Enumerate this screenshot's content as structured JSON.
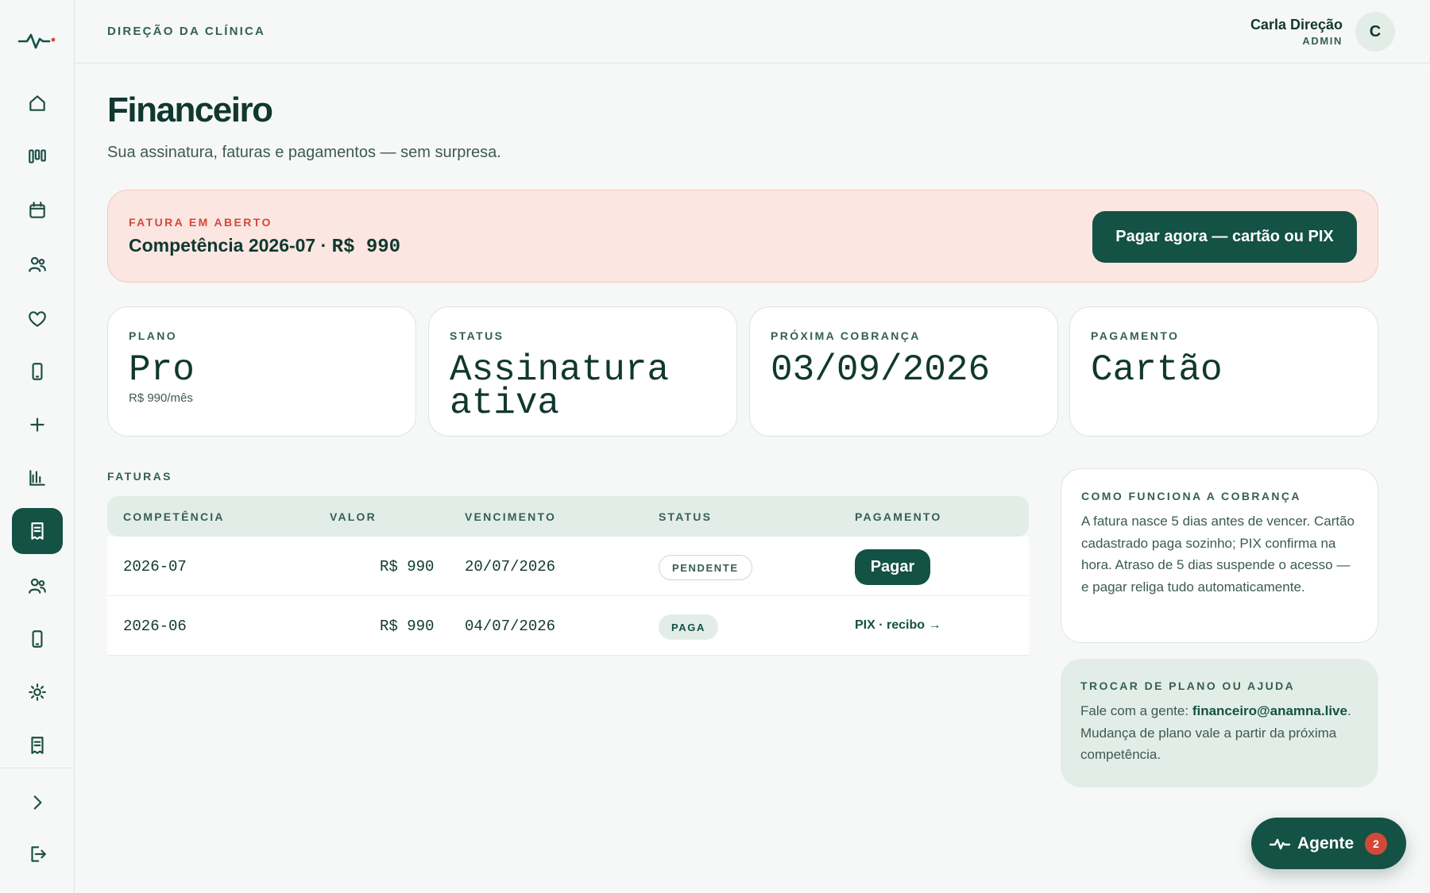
{
  "topbar": {
    "org": "DIREÇÃO DA CLÍNICA",
    "user_name": "Carla Direção",
    "user_role": "ADMIN",
    "avatar_initial": "C"
  },
  "sidebar": {
    "items": [
      {
        "icon": "home-icon"
      },
      {
        "icon": "kanban-icon"
      },
      {
        "icon": "calendar-icon"
      },
      {
        "icon": "patients-icon"
      },
      {
        "icon": "heart-icon"
      },
      {
        "icon": "phone-icon"
      },
      {
        "icon": "plus-icon"
      },
      {
        "icon": "bar-chart-icon"
      },
      {
        "icon": "receipt-icon",
        "active": true
      },
      {
        "icon": "team-icon"
      },
      {
        "icon": "tablet-icon"
      },
      {
        "icon": "sun-icon"
      },
      {
        "icon": "document-icon"
      },
      {
        "icon": "chevron-right-icon"
      },
      {
        "icon": "logout-icon"
      }
    ]
  },
  "header": {
    "title": "Financeiro",
    "subtitle": "Sua assinatura, faturas e pagamentos — sem surpresa."
  },
  "alert": {
    "label": "FATURA EM ABERTO",
    "text_prefix": "Competência 2026-07 · ",
    "text_amount": "R$ 990",
    "button": "Pagar agora — cartão ou PIX"
  },
  "cards": {
    "plan": {
      "label": "PLANO",
      "value": "Pro",
      "sub": "R$ 990/mês"
    },
    "status": {
      "label": "STATUS",
      "value_line1": "Assinatura",
      "value_line2": "ativa"
    },
    "next": {
      "label": "PRÓXIMA COBRANÇA",
      "value": "03/09/2026"
    },
    "payment": {
      "label": "PAGAMENTO",
      "value": "Cartão"
    }
  },
  "invoices": {
    "label": "FATURAS",
    "columns": [
      "COMPETÊNCIA",
      "VALOR",
      "VENCIMENTO",
      "STATUS",
      "PAGAMENTO"
    ],
    "rows": [
      {
        "period": "2026-07",
        "amount": "R$ 990",
        "due": "20/07/2026",
        "status": "PENDENTE",
        "action": "Pagar"
      },
      {
        "period": "2026-06",
        "amount": "R$ 990",
        "due": "04/07/2026",
        "status": "PAGA",
        "action": "PIX · recibo →"
      }
    ]
  },
  "info_how": {
    "label": "COMO FUNCIONA A COBRANÇA",
    "text": "A fatura nasce 5 dias antes de vencer. Cartão cadastrado paga sozinho; PIX confirma na hora. Atraso de 5 dias suspende o acesso — e pagar religa tudo automaticamente."
  },
  "info_help": {
    "label": "TROCAR DE PLANO OU AJUDA",
    "text_prefix": "Fale com a gente: ",
    "email": "financeiro@anamna.live",
    "text_suffix": ". Mudança de plano vale a partir da próxima competência."
  },
  "agent": {
    "label": "Agente",
    "count": "2"
  },
  "colors": {
    "primary": "#135244",
    "text": "#10382f",
    "alert_bg": "#fbe6e1",
    "alert_accent": "#d2493a",
    "muted_bg": "#e3ede8"
  }
}
